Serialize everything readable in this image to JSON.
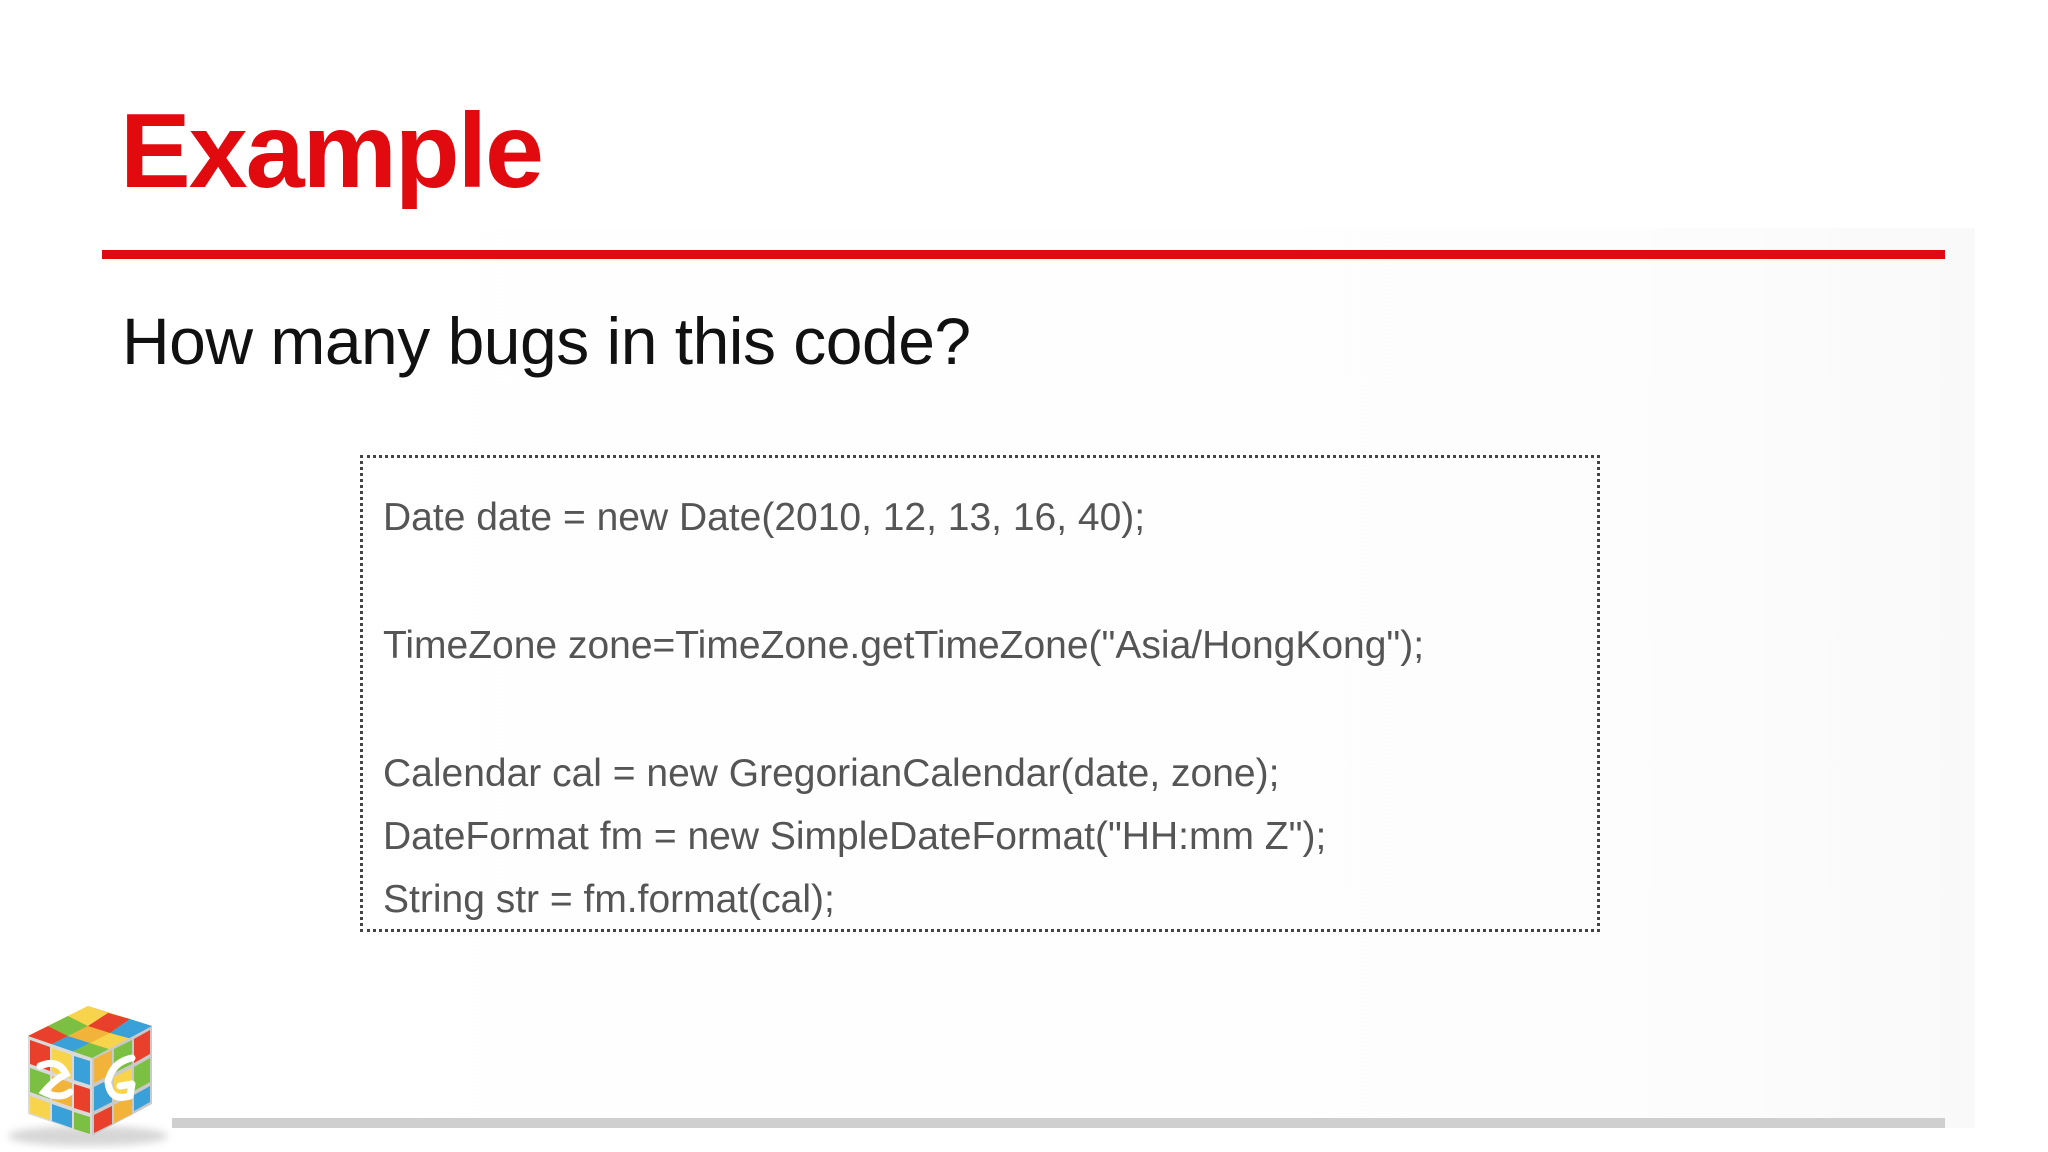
{
  "slide": {
    "title": "Example",
    "question": "How many bugs in this code?",
    "code_lines": [
      "Date date = new Date(2010, 12, 13, 16, 40);",
      "TimeZone zone=TimeZone.getTimeZone(\"Asia/HongKong\");",
      "Calendar cal = new GregorianCalendar(date, zone);",
      "DateFormat fm = new SimpleDateFormat(\"HH:mm Z\");",
      "String str = fm.format(cal);"
    ]
  },
  "logo": {
    "icon": "rubiks-cube-logo-icon"
  },
  "colors": {
    "accent": "#e00a0f",
    "code_text": "#555555",
    "bottom_rule": "#cfcfcf"
  }
}
